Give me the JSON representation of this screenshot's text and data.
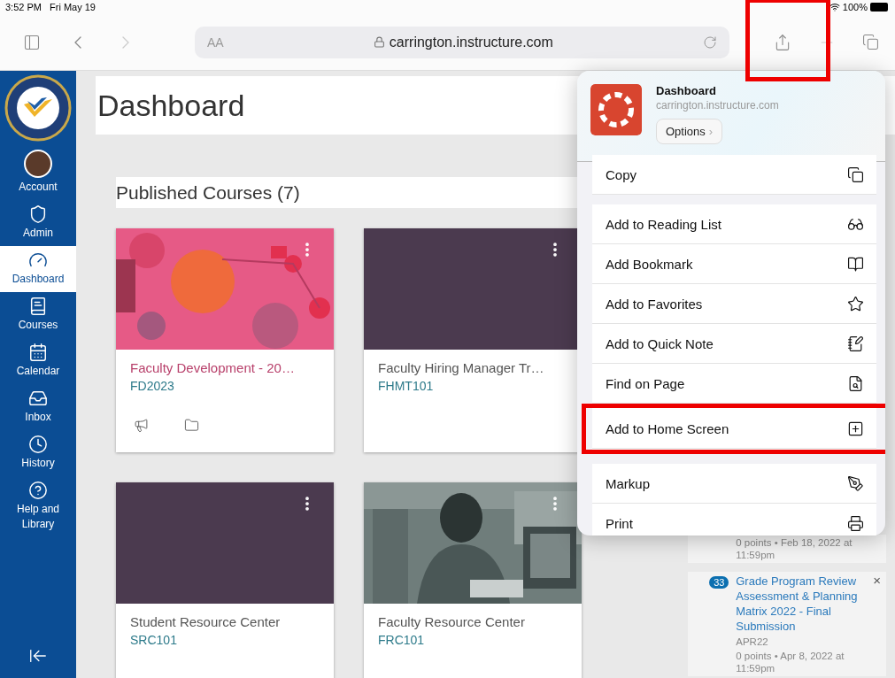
{
  "status_bar": {
    "time": "3:52 PM",
    "date": "Fri May 19",
    "battery": "100%"
  },
  "browser": {
    "text_size_button": "AA",
    "url": "carrington.instructure.com",
    "share_highlighted": true
  },
  "sidebar": {
    "items": [
      {
        "label": "Account",
        "kind": "avatar",
        "selected": false
      },
      {
        "label": "Admin",
        "kind": "admin",
        "selected": false
      },
      {
        "label": "Dashboard",
        "kind": "dashboard",
        "selected": true
      },
      {
        "label": "Courses",
        "kind": "courses",
        "selected": false
      },
      {
        "label": "Calendar",
        "kind": "calendar",
        "selected": false
      },
      {
        "label": "Inbox",
        "kind": "inbox",
        "selected": false
      },
      {
        "label": "History",
        "kind": "history",
        "selected": false
      },
      {
        "label": "Help and Library",
        "kind": "help",
        "selected": false
      }
    ]
  },
  "page": {
    "title": "Dashboard",
    "section_title": "Published Courses (7)",
    "courses": [
      {
        "title": "Faculty Development - 20…",
        "code": "FD2023",
        "kind": "picture",
        "color": "#b8406b",
        "actions_visible": true
      },
      {
        "title": "Faculty Hiring Manager Tr…",
        "code": "FHMT101",
        "kind": "plain",
        "color": "#555555",
        "actions_visible": false
      },
      {
        "title": "Student Resource Center",
        "code": "SRC101",
        "kind": "plain",
        "color": "#555555",
        "actions_visible": false
      },
      {
        "title": "Faculty Resource Center",
        "code": "FRC101",
        "color": "#555555",
        "actions_visible": false
      }
    ]
  },
  "todo": [
    {
      "details": "0 points • Feb 18, 2022 at 11:59pm"
    },
    {
      "badge": "33",
      "title": "Grade Program Review Assessment & Planning Matrix 2022 - Final Submission",
      "code": "APR22",
      "details": "0 points • Apr 8, 2022 at 11:59pm",
      "close": "×"
    }
  ],
  "share_sheet": {
    "title": "Dashboard",
    "subtitle": "carrington.instructure.com",
    "options_button": "Options",
    "options_chevron": "›",
    "groups": [
      {
        "items": [
          {
            "label": "Copy",
            "kind": "copy",
            "highlighted": false
          }
        ]
      },
      {
        "items": [
          {
            "label": "Add to Reading List",
            "kind": "glasses",
            "highlighted": false
          },
          {
            "label": "Add Bookmark",
            "kind": "book",
            "highlighted": false
          },
          {
            "label": "Add to Favorites",
            "kind": "star",
            "highlighted": false
          },
          {
            "label": "Add to Quick Note",
            "kind": "note",
            "highlighted": false
          },
          {
            "label": "Find on Page",
            "kind": "find",
            "highlighted": false
          },
          {
            "label": "Add to Home Screen",
            "kind": "plus",
            "highlighted": true
          }
        ]
      },
      {
        "items": [
          {
            "label": "Markup",
            "kind": "markup",
            "highlighted": false
          },
          {
            "label": "Print",
            "kind": "print",
            "highlighted": false
          }
        ]
      }
    ]
  }
}
